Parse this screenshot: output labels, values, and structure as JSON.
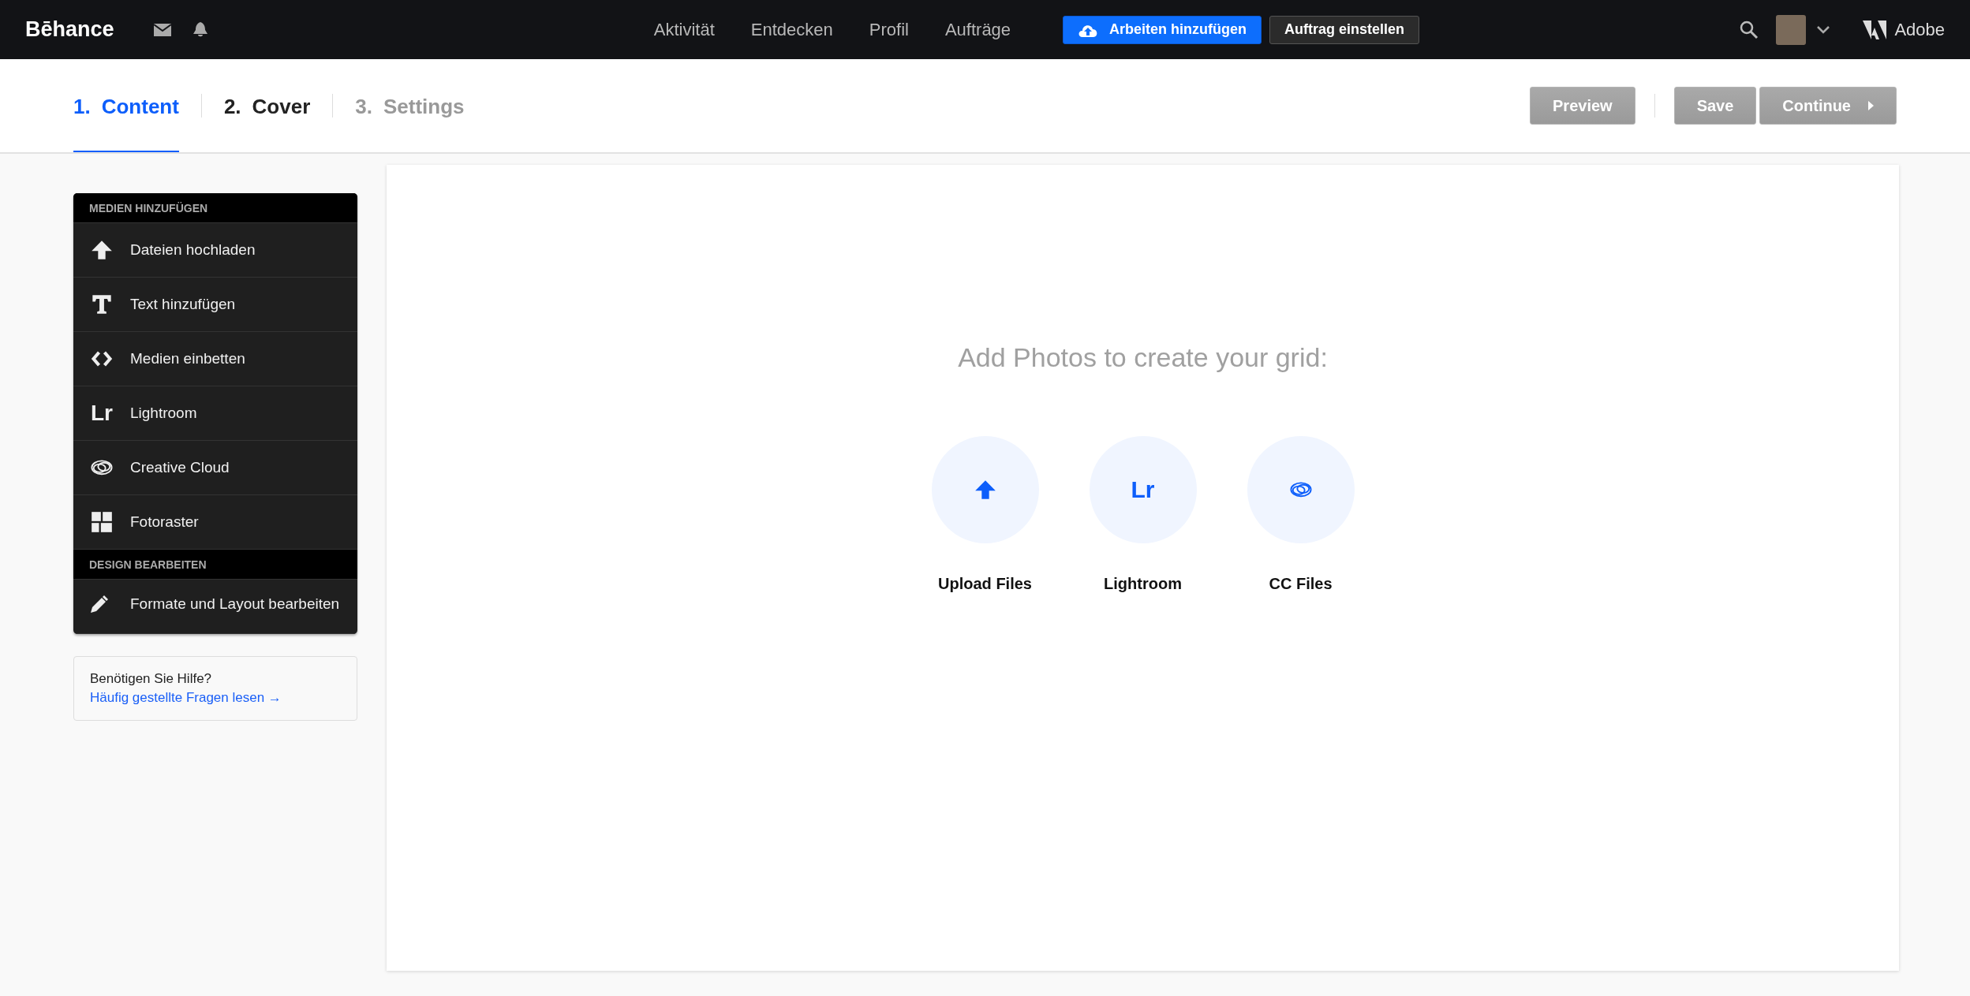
{
  "topbar": {
    "logo": "Bēhance",
    "nav": [
      "Aktivität",
      "Entdecken",
      "Profil",
      "Aufträge"
    ],
    "primary_button": "Arbeiten hinzufügen",
    "secondary_button": "Auftrag einstellen",
    "brand": "Adobe"
  },
  "steps": [
    {
      "number": "1.",
      "label": "Content",
      "selected": true,
      "disabled": false
    },
    {
      "number": "2.",
      "label": "Cover",
      "selected": false,
      "disabled": false
    },
    {
      "number": "3.",
      "label": "Settings",
      "selected": false,
      "disabled": true
    }
  ],
  "actions": [
    {
      "label": "Preview",
      "disabled": true,
      "kind": "plain"
    },
    {
      "label": "Save",
      "disabled": true,
      "kind": "plain"
    },
    {
      "label": "Continue",
      "disabled": true,
      "kind": "next"
    }
  ],
  "sidebar": {
    "sections": [
      {
        "title": "MEDIEN HINZUFÜGEN",
        "items": [
          {
            "kind": "upload",
            "label": "Dateien hochladen"
          },
          {
            "kind": "text",
            "label": "Text hinzufügen"
          },
          {
            "kind": "embed",
            "label": "Medien einbetten"
          },
          {
            "kind": "lightroom",
            "icon_text": "Lr",
            "label": "Lightroom"
          },
          {
            "kind": "cc",
            "label": "Creative Cloud"
          },
          {
            "kind": "grid",
            "label": "Fotoraster"
          }
        ]
      },
      {
        "title": "DESIGN BEARBEITEN",
        "items": [
          {
            "kind": "edit",
            "label": "Formate und Layout bearbeiten"
          }
        ]
      }
    ]
  },
  "help": {
    "text": "Benötigen Sie Hilfe?",
    "link": "Häufig gestellte Fragen lesen →"
  },
  "canvas": {
    "heading": "Add Photos to create your grid:",
    "sources": [
      {
        "kind": "upload",
        "label": "Upload Files"
      },
      {
        "kind": "lightroom",
        "icon_text": "Lr",
        "label": "Lightroom"
      },
      {
        "kind": "cc",
        "label": "CC Files"
      }
    ]
  }
}
